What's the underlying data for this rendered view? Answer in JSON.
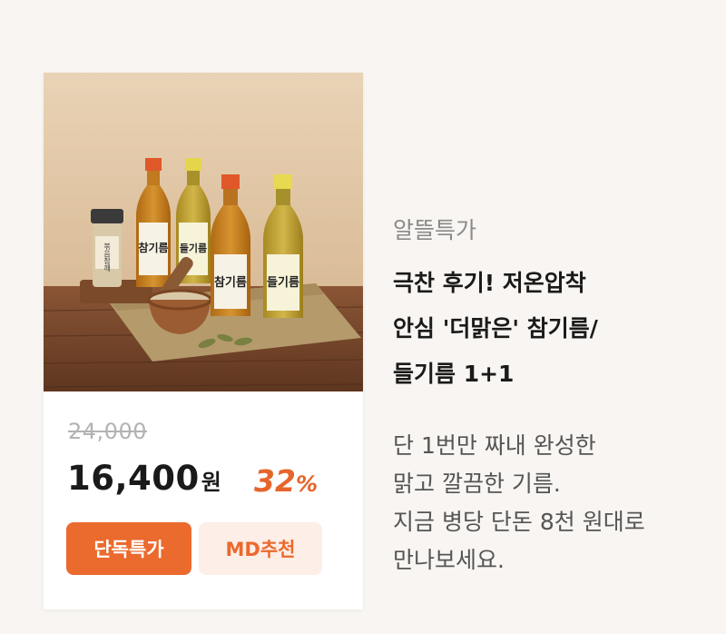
{
  "product_card": {
    "image_alt": "참기름 들기름 병과 깨소금 사진",
    "bottle_labels": [
      "참기름",
      "들기름",
      "참기름",
      "들기름"
    ],
    "jar_label": "볶음참깨",
    "original_price": "24,000",
    "sale_price": "16,400",
    "currency": "원",
    "discount_value": "32",
    "discount_unit": "%",
    "badges": [
      "단독특가",
      "MD추천"
    ]
  },
  "info": {
    "category": "알뜰특가",
    "title_lines": [
      "극찬 후기! 저온압착",
      "안심 '더맑은' 참기름/",
      "들기름 1+1"
    ],
    "description_lines": [
      "단 1번만 짜내 완성한",
      "맑고 깔끔한 기름.",
      "지금 병당 단돈 8천 원대로",
      "만나보세요."
    ]
  },
  "colors": {
    "background": "#f8f5f2",
    "accent": "#eb6a2d",
    "badge_light": "#fdeee7",
    "text_dark": "#1a1a1a",
    "text_gray": "#8a8a8a"
  }
}
